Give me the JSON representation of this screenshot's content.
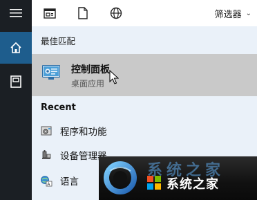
{
  "rail": {
    "items": [
      {
        "name": "hamburger-menu-icon"
      },
      {
        "name": "home-icon",
        "active": true
      },
      {
        "name": "notebook-icon"
      }
    ]
  },
  "topbar": {
    "icons": [
      "apps-icon",
      "documents-icon",
      "web-icon"
    ],
    "filter_label": "筛选器",
    "filter_chevron": "⌄"
  },
  "best_match": {
    "header": "最佳匹配",
    "title": "控制面板",
    "subtitle": "桌面应用"
  },
  "recent": {
    "header": "Recent",
    "items": [
      {
        "label": "程序和功能",
        "icon": "programs-features-icon"
      },
      {
        "label": "设备管理器",
        "icon": "device-manager-icon"
      },
      {
        "label": "语言",
        "icon": "language-icon"
      }
    ]
  },
  "watermark": {
    "ghost_text": "系统之家",
    "text": "系统之家"
  },
  "colors": {
    "rail_bg": "#1b1f24",
    "rail_active": "#1e5d8d",
    "panel_bg": "#eaf1f9",
    "selected_bg": "#c9c9c9"
  }
}
